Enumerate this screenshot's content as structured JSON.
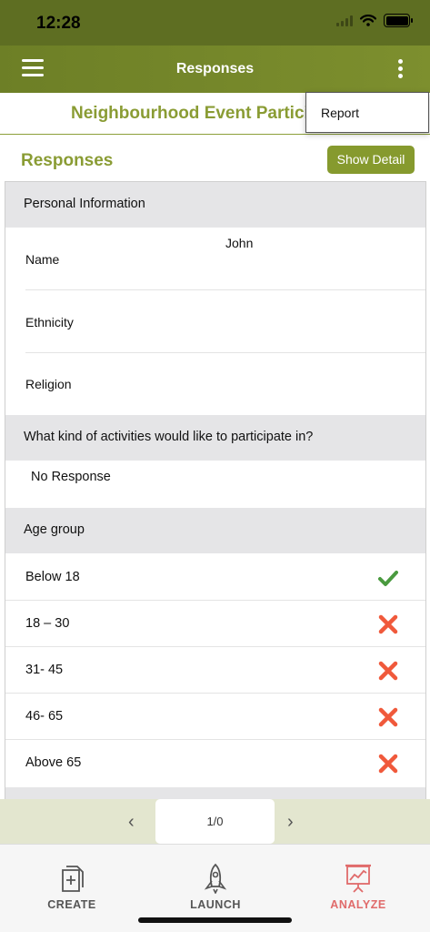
{
  "status_bar": {
    "time": "12:28"
  },
  "nav": {
    "title": "Responses"
  },
  "survey": {
    "title": "Neighbourhood Event Participation"
  },
  "popup_menu": {
    "items": [
      {
        "label": "Report"
      }
    ]
  },
  "section": {
    "title": "Responses",
    "show_detail_label": "Show Detail"
  },
  "groups": {
    "personal": {
      "title": "Personal Information",
      "fields": [
        {
          "label": "Name",
          "value": "John"
        },
        {
          "label": "Ethnicity",
          "value": ""
        },
        {
          "label": "Religion",
          "value": ""
        }
      ]
    },
    "activities": {
      "title": "What kind of activities would like to participate in?",
      "response": "No Response"
    },
    "age": {
      "title": "Age group",
      "options": [
        {
          "label": "Below 18",
          "selected": true
        },
        {
          "label": "18 – 30",
          "selected": false
        },
        {
          "label": "31- 45",
          "selected": false
        },
        {
          "label": "46- 65",
          "selected": false
        },
        {
          "label": "Above 65",
          "selected": false
        }
      ]
    }
  },
  "pager": {
    "label": "1/0",
    "prev_icon": "chevron-left-icon",
    "next_icon": "chevron-right-icon"
  },
  "tabs": [
    {
      "label": "CREATE",
      "icon": "create-document-icon",
      "active": false
    },
    {
      "label": "LAUNCH",
      "icon": "rocket-icon",
      "active": false
    },
    {
      "label": "ANALYZE",
      "icon": "presentation-chart-icon",
      "active": true
    }
  ],
  "colors": {
    "nav": "#6d7f26",
    "accent": "#8a9c34",
    "check": "#4a9a3f",
    "cross": "#f0593b",
    "active_tab": "#e06b6b"
  }
}
